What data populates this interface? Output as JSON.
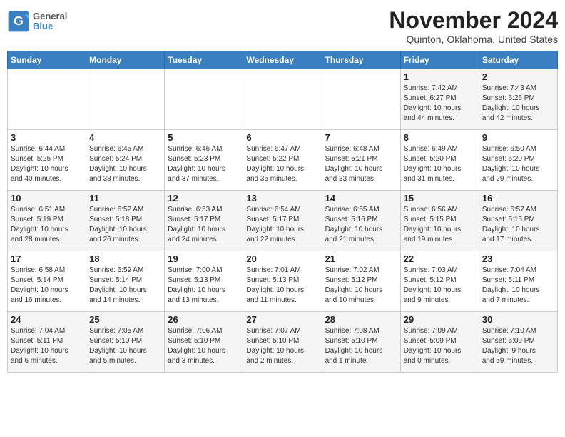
{
  "logo": {
    "general": "General",
    "blue": "Blue"
  },
  "title": "November 2024",
  "location": "Quinton, Oklahoma, United States",
  "weekdays": [
    "Sunday",
    "Monday",
    "Tuesday",
    "Wednesday",
    "Thursday",
    "Friday",
    "Saturday"
  ],
  "weeks": [
    [
      {
        "day": "",
        "info": ""
      },
      {
        "day": "",
        "info": ""
      },
      {
        "day": "",
        "info": ""
      },
      {
        "day": "",
        "info": ""
      },
      {
        "day": "",
        "info": ""
      },
      {
        "day": "1",
        "info": "Sunrise: 7:42 AM\nSunset: 6:27 PM\nDaylight: 10 hours\nand 44 minutes."
      },
      {
        "day": "2",
        "info": "Sunrise: 7:43 AM\nSunset: 6:26 PM\nDaylight: 10 hours\nand 42 minutes."
      }
    ],
    [
      {
        "day": "3",
        "info": "Sunrise: 6:44 AM\nSunset: 5:25 PM\nDaylight: 10 hours\nand 40 minutes."
      },
      {
        "day": "4",
        "info": "Sunrise: 6:45 AM\nSunset: 5:24 PM\nDaylight: 10 hours\nand 38 minutes."
      },
      {
        "day": "5",
        "info": "Sunrise: 6:46 AM\nSunset: 5:23 PM\nDaylight: 10 hours\nand 37 minutes."
      },
      {
        "day": "6",
        "info": "Sunrise: 6:47 AM\nSunset: 5:22 PM\nDaylight: 10 hours\nand 35 minutes."
      },
      {
        "day": "7",
        "info": "Sunrise: 6:48 AM\nSunset: 5:21 PM\nDaylight: 10 hours\nand 33 minutes."
      },
      {
        "day": "8",
        "info": "Sunrise: 6:49 AM\nSunset: 5:20 PM\nDaylight: 10 hours\nand 31 minutes."
      },
      {
        "day": "9",
        "info": "Sunrise: 6:50 AM\nSunset: 5:20 PM\nDaylight: 10 hours\nand 29 minutes."
      }
    ],
    [
      {
        "day": "10",
        "info": "Sunrise: 6:51 AM\nSunset: 5:19 PM\nDaylight: 10 hours\nand 28 minutes."
      },
      {
        "day": "11",
        "info": "Sunrise: 6:52 AM\nSunset: 5:18 PM\nDaylight: 10 hours\nand 26 minutes."
      },
      {
        "day": "12",
        "info": "Sunrise: 6:53 AM\nSunset: 5:17 PM\nDaylight: 10 hours\nand 24 minutes."
      },
      {
        "day": "13",
        "info": "Sunrise: 6:54 AM\nSunset: 5:17 PM\nDaylight: 10 hours\nand 22 minutes."
      },
      {
        "day": "14",
        "info": "Sunrise: 6:55 AM\nSunset: 5:16 PM\nDaylight: 10 hours\nand 21 minutes."
      },
      {
        "day": "15",
        "info": "Sunrise: 6:56 AM\nSunset: 5:15 PM\nDaylight: 10 hours\nand 19 minutes."
      },
      {
        "day": "16",
        "info": "Sunrise: 6:57 AM\nSunset: 5:15 PM\nDaylight: 10 hours\nand 17 minutes."
      }
    ],
    [
      {
        "day": "17",
        "info": "Sunrise: 6:58 AM\nSunset: 5:14 PM\nDaylight: 10 hours\nand 16 minutes."
      },
      {
        "day": "18",
        "info": "Sunrise: 6:59 AM\nSunset: 5:14 PM\nDaylight: 10 hours\nand 14 minutes."
      },
      {
        "day": "19",
        "info": "Sunrise: 7:00 AM\nSunset: 5:13 PM\nDaylight: 10 hours\nand 13 minutes."
      },
      {
        "day": "20",
        "info": "Sunrise: 7:01 AM\nSunset: 5:13 PM\nDaylight: 10 hours\nand 11 minutes."
      },
      {
        "day": "21",
        "info": "Sunrise: 7:02 AM\nSunset: 5:12 PM\nDaylight: 10 hours\nand 10 minutes."
      },
      {
        "day": "22",
        "info": "Sunrise: 7:03 AM\nSunset: 5:12 PM\nDaylight: 10 hours\nand 9 minutes."
      },
      {
        "day": "23",
        "info": "Sunrise: 7:04 AM\nSunset: 5:11 PM\nDaylight: 10 hours\nand 7 minutes."
      }
    ],
    [
      {
        "day": "24",
        "info": "Sunrise: 7:04 AM\nSunset: 5:11 PM\nDaylight: 10 hours\nand 6 minutes."
      },
      {
        "day": "25",
        "info": "Sunrise: 7:05 AM\nSunset: 5:10 PM\nDaylight: 10 hours\nand 5 minutes."
      },
      {
        "day": "26",
        "info": "Sunrise: 7:06 AM\nSunset: 5:10 PM\nDaylight: 10 hours\nand 3 minutes."
      },
      {
        "day": "27",
        "info": "Sunrise: 7:07 AM\nSunset: 5:10 PM\nDaylight: 10 hours\nand 2 minutes."
      },
      {
        "day": "28",
        "info": "Sunrise: 7:08 AM\nSunset: 5:10 PM\nDaylight: 10 hours\nand 1 minute."
      },
      {
        "day": "29",
        "info": "Sunrise: 7:09 AM\nSunset: 5:09 PM\nDaylight: 10 hours\nand 0 minutes."
      },
      {
        "day": "30",
        "info": "Sunrise: 7:10 AM\nSunset: 5:09 PM\nDaylight: 9 hours\nand 59 minutes."
      }
    ]
  ]
}
